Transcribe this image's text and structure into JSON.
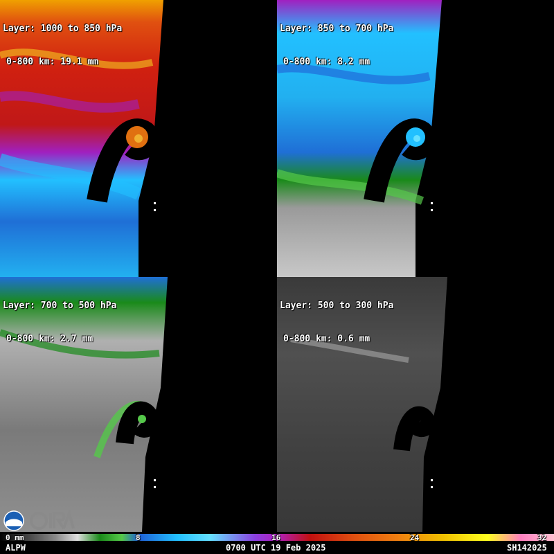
{
  "panels": [
    {
      "title": "Layer: 1000 to 850 hPa",
      "subtitle": "0-800 km: 19.1 mm"
    },
    {
      "title": "Layer: 850 to 700 hPa",
      "subtitle": "0-800 km: 8.2 mm"
    },
    {
      "title": "Layer: 700 to 500 hPa",
      "subtitle": "0-800 km: 2.7 mm"
    },
    {
      "title": "Layer: 500 to 300 hPa",
      "subtitle": "0-800 km: 0.6 mm"
    }
  ],
  "colorbar": {
    "unit_label": "0 mm",
    "ticks": [
      "8",
      "16",
      "24",
      "32"
    ]
  },
  "footer": {
    "product": "ALPW",
    "time": "0700 UTC 19 Feb 2025",
    "storm_id": "SH142025"
  },
  "logos": {
    "noaa": "NOAA",
    "cira": "CIRA"
  },
  "colors": {
    "moist": "#d02010",
    "mid": "#22c0ff",
    "dry": "#888888",
    "background": "#000000"
  }
}
